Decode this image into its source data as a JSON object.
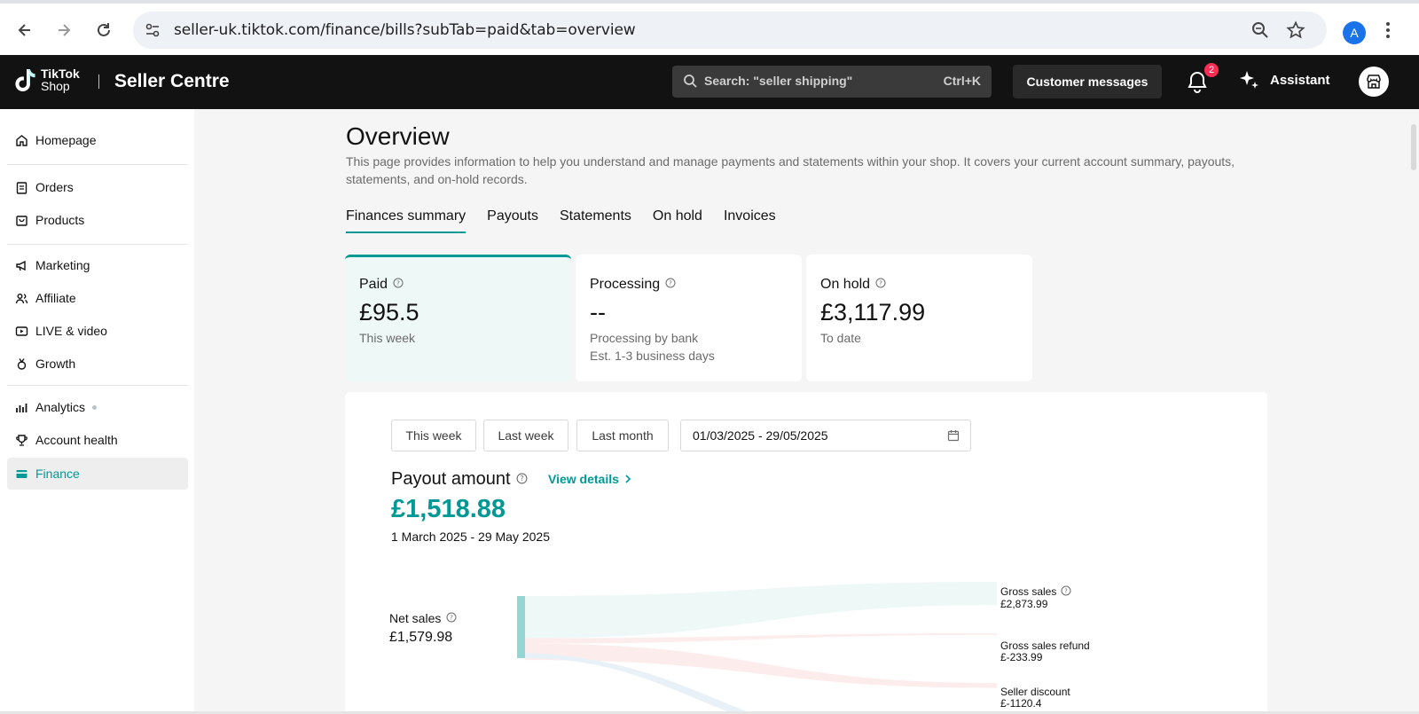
{
  "browser": {
    "url": "seller-uk.tiktok.com/finance/bills?subTab=paid&tab=overview",
    "profile_initial": "A"
  },
  "header": {
    "logo_line1": "TikTok",
    "logo_line2": "Shop",
    "app_title": "Seller Centre",
    "search_placeholder": "Search: \"seller shipping\"",
    "search_shortcut": "Ctrl+K",
    "customer_messages": "Customer messages",
    "notification_count": "2",
    "assistant": "Assistant"
  },
  "sidebar": {
    "items": [
      {
        "label": "Homepage",
        "icon": "home-icon"
      },
      {
        "label": "Orders",
        "icon": "clipboard-icon"
      },
      {
        "label": "Products",
        "icon": "bag-icon"
      },
      {
        "label": "Marketing",
        "icon": "megaphone-icon"
      },
      {
        "label": "Affiliate",
        "icon": "people-icon"
      },
      {
        "label": "LIVE & video",
        "icon": "video-icon"
      },
      {
        "label": "Growth",
        "icon": "medal-icon"
      },
      {
        "label": "Analytics",
        "icon": "bar-chart-icon"
      },
      {
        "label": "Account health",
        "icon": "trophy-icon"
      },
      {
        "label": "Finance",
        "icon": "card-icon"
      }
    ],
    "active": "Finance"
  },
  "main": {
    "title": "Overview",
    "description": "This page provides information to help you understand and manage payments and statements within your shop. It covers your current account summary, payouts, statements, and on-hold records.",
    "tabs": [
      "Finances summary",
      "Payouts",
      "Statements",
      "On hold",
      "Invoices"
    ],
    "active_tab": "Finances summary",
    "cards": [
      {
        "label": "Paid",
        "value": "£95.5",
        "sub": "This week"
      },
      {
        "label": "Processing",
        "value": "--",
        "sub": "Processing by bank",
        "sub2": "Est. 1-3 business days"
      },
      {
        "label": "On hold",
        "value": "£3,117.99",
        "sub": "To date"
      }
    ],
    "range_buttons": [
      "This week",
      "Last week",
      "Last month"
    ],
    "date_range": "01/03/2025 - 29/05/2025",
    "payout_title": "Payout amount",
    "view_details": "View details",
    "payout_amount": "£1,518.88",
    "payout_period": "1 March 2025 - 29 May 2025"
  },
  "chart_data": {
    "type": "sankey",
    "source": {
      "name": "Net sales",
      "value": "£1,579.98"
    },
    "targets": [
      {
        "name": "Gross sales",
        "value": "£2,873.99",
        "amount": 2873.99
      },
      {
        "name": "Gross sales refund",
        "value": "£-233.99",
        "amount": -233.99
      },
      {
        "name": "Seller discount",
        "value": "£-1120.4",
        "amount": -1120.4
      }
    ],
    "colors": {
      "node": "#93d6d3",
      "positive": "#eef8f7",
      "negative": "#fdecec",
      "other": "#e8f1f8"
    }
  }
}
